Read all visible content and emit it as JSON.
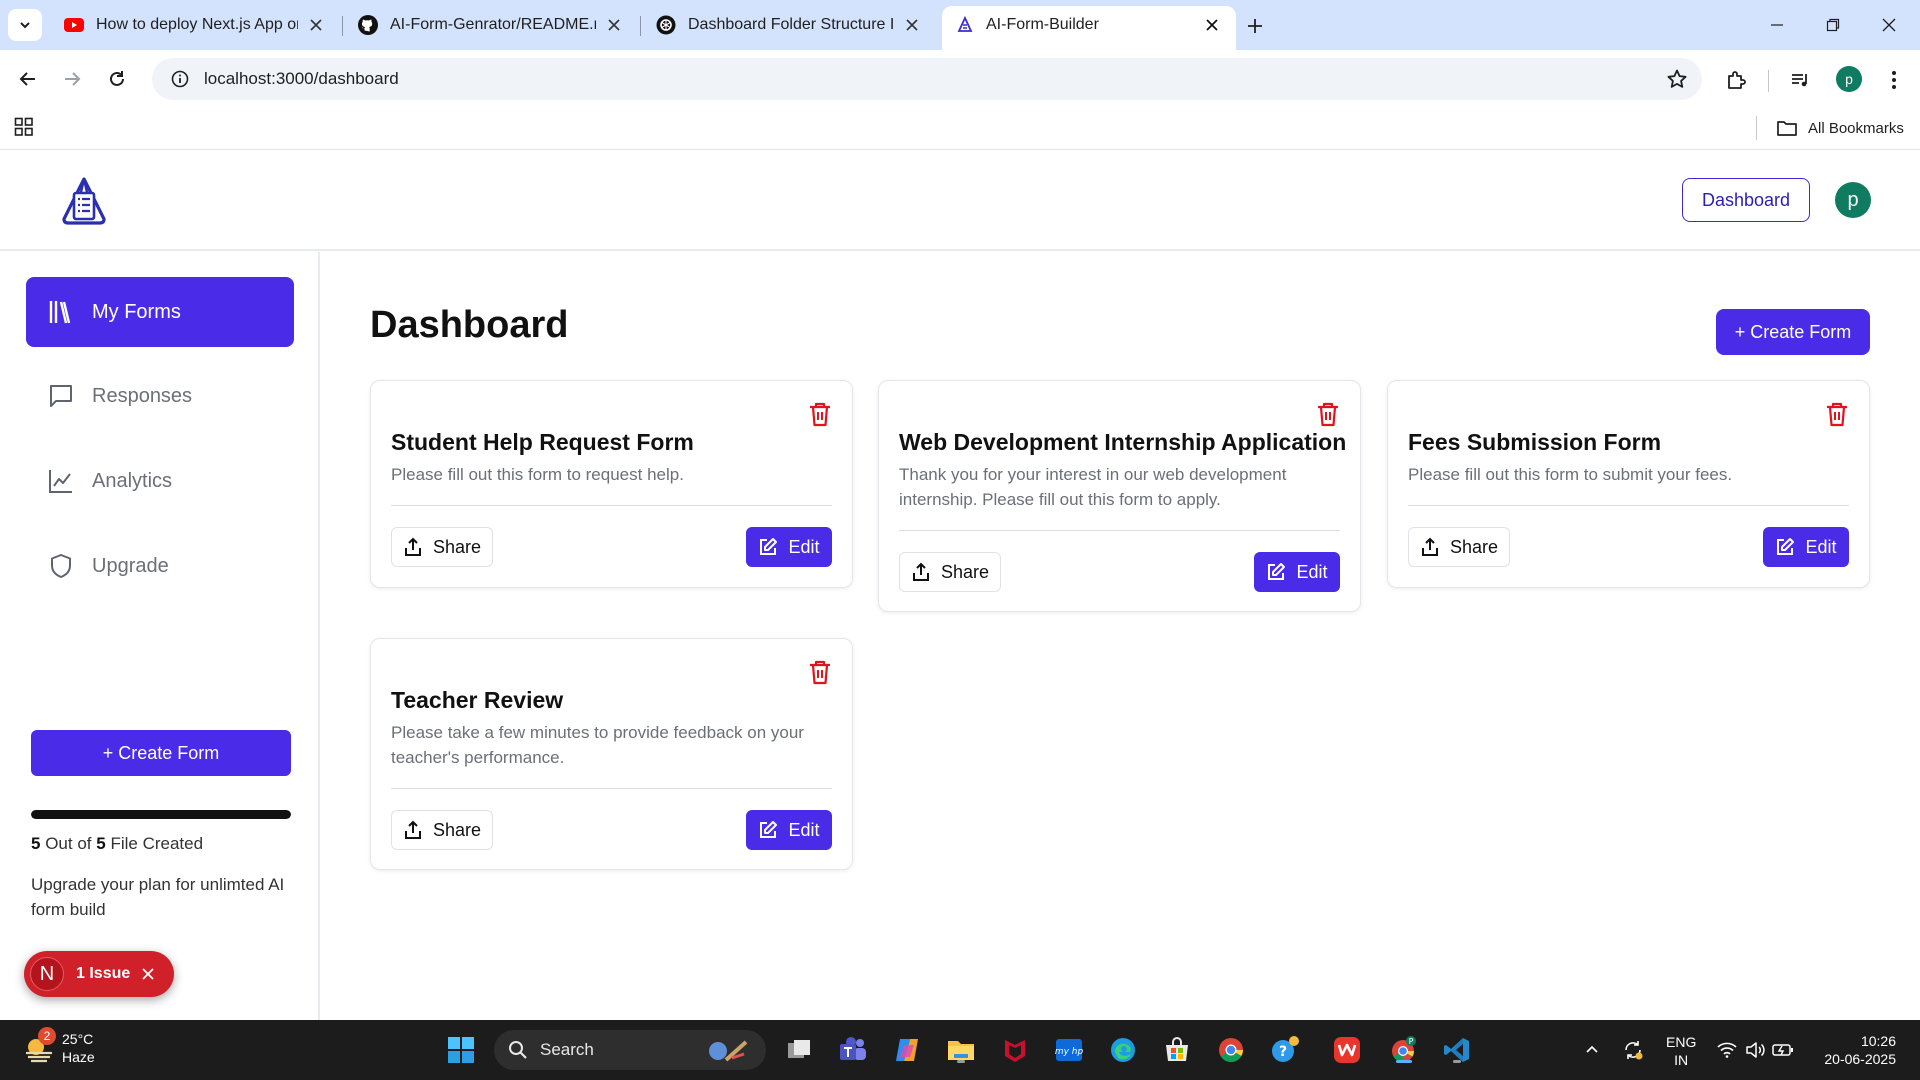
{
  "browser": {
    "tabs": [
      {
        "title": "How to deploy Next.js App on Vercel",
        "favicon": "youtube-icon"
      },
      {
        "title": "AI-Form-Genrator/README.md",
        "favicon": "github-icon"
      },
      {
        "title": "Dashboard Folder Structure Issue",
        "favicon": "chatgpt-icon"
      },
      {
        "title": "AI-Form-Builder",
        "favicon": "app-logo-icon",
        "active": true
      }
    ],
    "url": "localhost:3000/dashboard",
    "profile_initial": "p",
    "bookmarks_label": "All Bookmarks"
  },
  "header": {
    "dashboard_label": "Dashboard",
    "avatar_initial": "p"
  },
  "sidebar": {
    "items": [
      {
        "label": "My Forms",
        "icon": "library-icon",
        "active": true
      },
      {
        "label": "Responses",
        "icon": "message-square-icon"
      },
      {
        "label": "Analytics",
        "icon": "line-chart-icon"
      },
      {
        "label": "Upgrade",
        "icon": "shield-icon"
      }
    ],
    "create_label": "+ Create Form",
    "progress": {
      "used": "5",
      "total": "5",
      "fraction": 1.0,
      "text_mid": "Out of",
      "text_end": "File Created"
    },
    "upgrade_text": "Upgrade your plan for unlimted AI form build"
  },
  "issue_badge": {
    "initial": "N",
    "label": "1 Issue"
  },
  "main": {
    "title": "Dashboard",
    "create_label": "+ Create Form",
    "forms": [
      {
        "title": "Student Help Request Form",
        "description": "Please fill out this form to request help.",
        "share_label": "Share",
        "edit_label": "Edit"
      },
      {
        "title": "Web Development Internship Application",
        "description": "Thank you for your interest in our web development internship. Please fill out this form to apply.",
        "share_label": "Share",
        "edit_label": "Edit"
      },
      {
        "title": "Fees Submission Form",
        "description": "Please fill out this form to submit your fees.",
        "share_label": "Share",
        "edit_label": "Edit"
      },
      {
        "title": "Teacher Review",
        "description": "Please take a few minutes to provide feedback on your teacher's performance.",
        "share_label": "Share",
        "edit_label": "Edit"
      }
    ]
  },
  "taskbar": {
    "weather": {
      "temp": "25°C",
      "condition": "Haze",
      "badge": "2"
    },
    "search_label": "Search",
    "lang": {
      "line1": "ENG",
      "line2": "IN"
    },
    "clock": {
      "time": "10:26",
      "date": "20-06-2025"
    }
  },
  "colors": {
    "accent": "#4a2ce8",
    "danger": "#d0202a",
    "avatar": "#0f7b60"
  }
}
